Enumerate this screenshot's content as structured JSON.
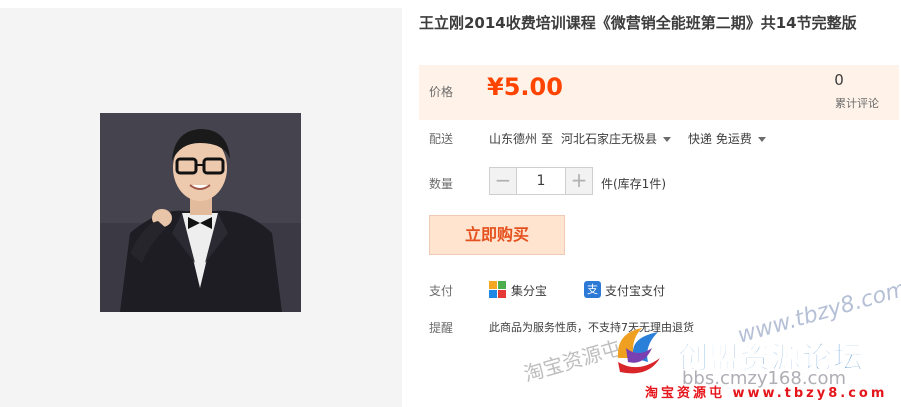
{
  "product": {
    "title": "王立刚2014收费培训课程《微营销全能班第二期》共14节完整版"
  },
  "price": {
    "label": "价格",
    "value": "¥5.00",
    "review_count": "0",
    "review_label": "累计评论"
  },
  "shipping": {
    "label": "配送",
    "origin": "山东德州",
    "to": "至",
    "destination": "河北石家庄无极县",
    "method": "快递 免运费"
  },
  "quantity": {
    "label": "数量",
    "minus": "−",
    "value": "1",
    "plus": "+",
    "stock": "件(库存1件)"
  },
  "buy_button": "立即购买",
  "payment": {
    "label": "支付",
    "option1": "集分宝",
    "option2": "支付宝支付"
  },
  "notice": {
    "label": "提醒",
    "text": "此商品为服务性质，不支持7天无理由退货"
  },
  "watermarks": {
    "site_url": "www.tbzy8.com",
    "shop_text": "淘宝资源屯",
    "forum_name": "创盟资源论坛",
    "forum_url": "bbs.cmzy168.com",
    "bottom_text": "淘宝资源屯 www.tbzy8.com"
  },
  "colors": {
    "price": "#ff4400",
    "price_bg": "#fff2e8",
    "buy_bg": "#ffe4d0",
    "watermark_blue": "#1a6fc4"
  }
}
